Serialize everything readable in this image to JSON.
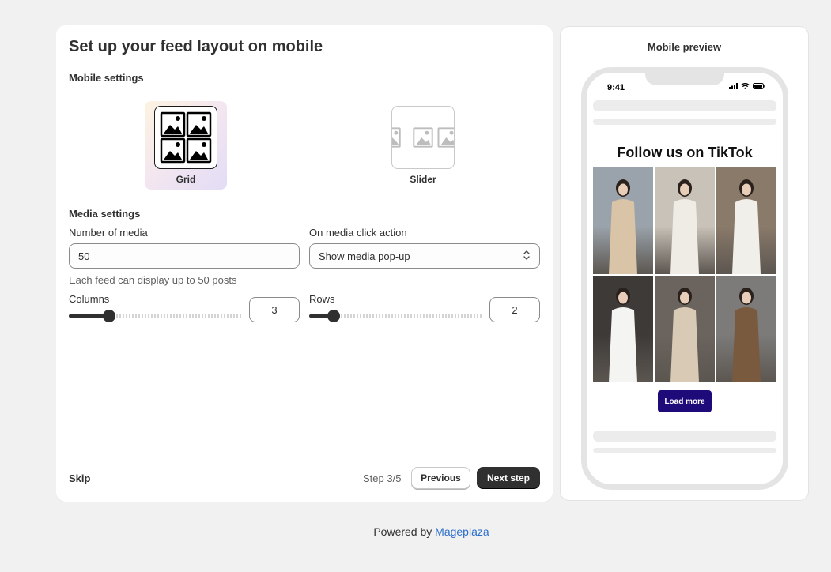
{
  "page": {
    "title": "Set up your feed layout on mobile",
    "mobile_settings_title": "Mobile settings",
    "layouts": [
      {
        "label": "Grid",
        "selected": true
      },
      {
        "label": "Slider",
        "selected": false
      }
    ],
    "media_settings_title": "Media settings",
    "number_of_media": {
      "label": "Number of media",
      "value": "50",
      "help": "Each feed can display up to 50 posts"
    },
    "click_action": {
      "label": "On media click action",
      "selected": "Show media pop-up"
    },
    "columns": {
      "label": "Columns",
      "value": "3",
      "level_fraction": 0.23
    },
    "rows": {
      "label": "Rows",
      "value": "2",
      "level_fraction": 0.14
    },
    "footer_actions": {
      "skip": "Skip",
      "step": "Step 3/5",
      "previous": "Previous",
      "next": "Next step"
    }
  },
  "preview": {
    "title": "Mobile preview",
    "time": "9:41",
    "feed_title": "Follow us on TikTok",
    "load_more": "Load more",
    "photos": [
      {
        "icon": "woman-beige-jumpsuit-photo",
        "bg": "#9aa3ab",
        "fg": "#d9c4a8"
      },
      {
        "icon": "woman-white-dress-photo",
        "bg": "#c9c2b8",
        "fg": "#efece6"
      },
      {
        "icon": "woman-black-top-white-pants-photo",
        "bg": "#8a7a6a",
        "fg": "#f1efe9"
      },
      {
        "icon": "woman-white-blazer-photo",
        "bg": "#3d3a38",
        "fg": "#f4f4f2"
      },
      {
        "icon": "woman-beige-trench-photo",
        "bg": "#6b645e",
        "fg": "#d8cab5"
      },
      {
        "icon": "woman-brown-coat-photo",
        "bg": "#7c7b7a",
        "fg": "#7a5a3e"
      }
    ]
  },
  "footer": {
    "prefix": "Powered by",
    "link": "Mageplaza"
  },
  "colors": {
    "primary_button": "#303030",
    "load_more": "#1f0a7a",
    "link": "#2c6ecb"
  }
}
